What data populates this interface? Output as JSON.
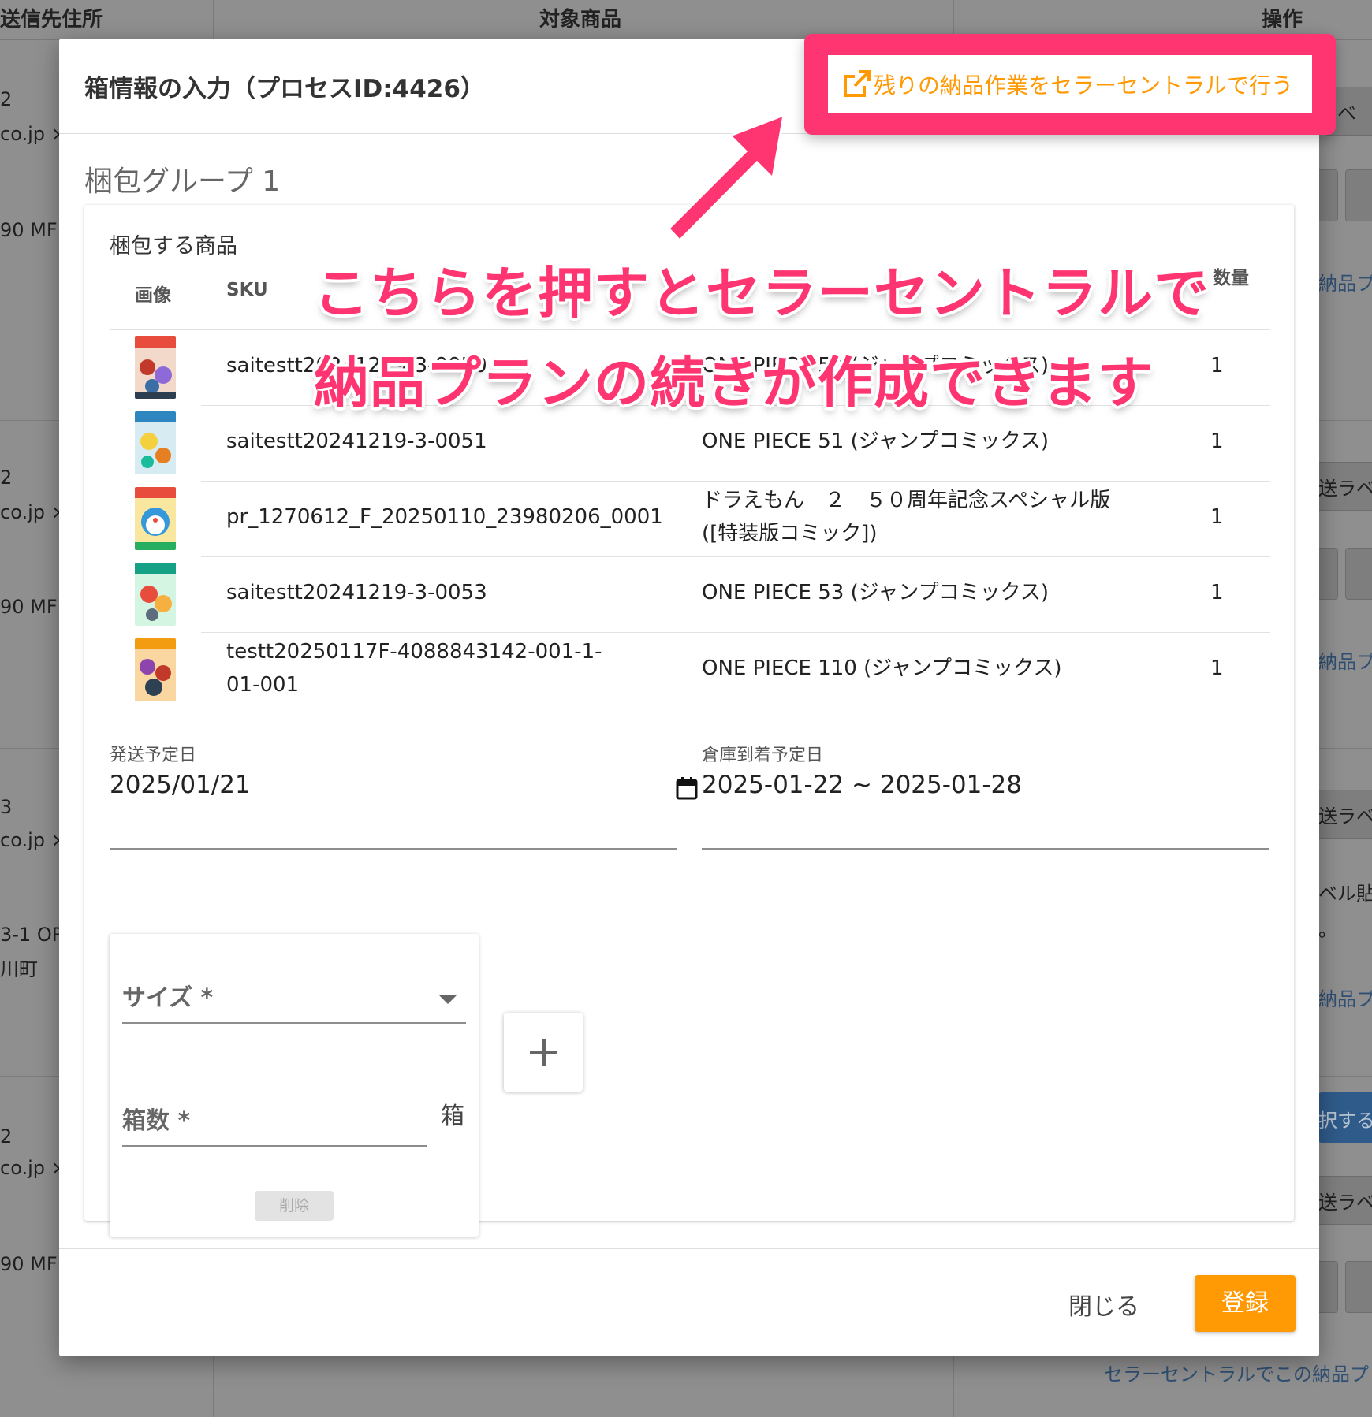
{
  "background": {
    "headers": [
      "送信先住所",
      "対象商品",
      "操作"
    ],
    "left_fragments": [
      "2",
      "co.jp ×",
      "90 MF",
      "2",
      "co.jp ×",
      "90 MF",
      "3",
      "co.jp ×",
      "3-1 OR",
      "川町",
      "2",
      "co.jp ×",
      "90 MF"
    ],
    "right_fragments": [
      "ラベ",
      "納品プ",
      "送ラベ",
      "納品プ",
      "送ラベ",
      "ベル貼",
      "。",
      "納品プ",
      "択する",
      "送ラベ"
    ],
    "bottom_link": "セラーセントラルでこの納品プ"
  },
  "dialog": {
    "title": "箱情報の入力（プロセスID:4426）",
    "external_link": "残りの納品作業をセラーセントラルで行う",
    "group_title": "梱包グループ 1",
    "products_label": "梱包する商品",
    "table": {
      "headers": {
        "image": "画像",
        "sku": "SKU",
        "qty": "数量"
      },
      "rows": [
        {
          "sku": "saitestt20241219-3-0050",
          "name": "ONE PIECE 50 (ジャンプコミックス)",
          "qty": "1"
        },
        {
          "sku": "saitestt20241219-3-0051",
          "name": "ONE PIECE 51 (ジャンプコミックス)",
          "qty": "1"
        },
        {
          "sku": "pr_1270612_F_20250110_23980206_0001",
          "name": "ドラえもん　２　５０周年記念スペシャル版([特装版コミック])",
          "qty": "1"
        },
        {
          "sku": "saitestt20241219-3-0053",
          "name": "ONE PIECE 53 (ジャンプコミックス)",
          "qty": "1"
        },
        {
          "sku": "testt20250117F-4088843142-001-1-01-001",
          "name": "ONE PIECE 110 (ジャンプコミックス)",
          "qty": "1"
        }
      ]
    },
    "ship_date": {
      "label": "発送予定日",
      "value": "2025/01/21"
    },
    "arrival_date": {
      "label": "倉庫到着予定日",
      "value": "2025-01-22 ~ 2025-01-28"
    },
    "box": {
      "size_label": "サイズ *",
      "count_label": "箱数 *",
      "unit": "箱",
      "delete_label": "削除"
    },
    "close_label": "閉じる",
    "submit_label": "登録"
  },
  "annotation": {
    "line1": "こちらを押すとセラーセントラルで",
    "line2": "納品プランの続きが作成できます"
  },
  "colors": {
    "accent_orange": "#ff9a05",
    "highlight_pink": "#fe3570"
  }
}
